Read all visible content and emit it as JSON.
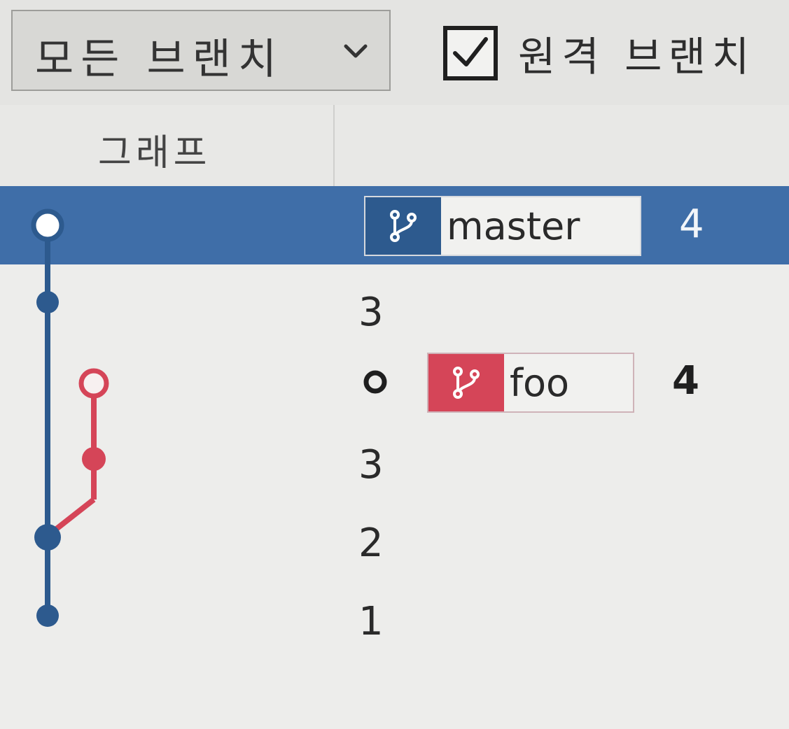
{
  "toolbar": {
    "branch_filter": {
      "selected": "모든 브랜치",
      "icon": "chevron-down-icon"
    },
    "remote_branches": {
      "label": "원격 브랜치",
      "checked": true
    }
  },
  "columns": {
    "graph": "그래프"
  },
  "colors": {
    "selected_row": "#3f6ea8",
    "master_branch": "#2d5a8e",
    "foo_branch": "#d54558",
    "background": "#ededeb"
  },
  "commits": [
    {
      "message": "",
      "branch": "master",
      "branch_icon": "branch-icon",
      "trailing": "4",
      "selected": true,
      "node": "hollow"
    },
    {
      "message": "3",
      "selected": false,
      "node": "filled"
    },
    {
      "message": "",
      "node_marker": "o",
      "branch": "foo",
      "branch_icon": "branch-icon",
      "trailing": "4",
      "selected": false,
      "node": "hollow"
    },
    {
      "message": "3",
      "selected": false,
      "node": "filled"
    },
    {
      "message": "2",
      "selected": false,
      "node": "filled"
    },
    {
      "message": "1",
      "selected": false,
      "node": "filled"
    }
  ]
}
